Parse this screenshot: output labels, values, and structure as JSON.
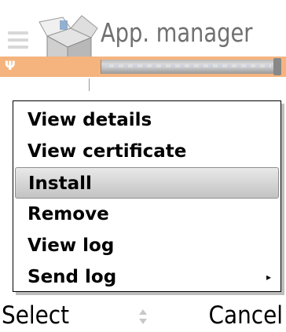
{
  "header": {
    "title": "App. manager",
    "app_icon": "package-box-icon",
    "signal_icon": "antenna-icon"
  },
  "menu": {
    "items": [
      {
        "label": "View details",
        "selected": false
      },
      {
        "label": "View certificate",
        "selected": false
      },
      {
        "label": "Install",
        "selected": true
      },
      {
        "label": "Remove",
        "selected": false
      },
      {
        "label": "View log",
        "selected": false
      },
      {
        "label": "Send log",
        "selected": false,
        "has_submenu": true
      }
    ],
    "submenu_arrow": "▸"
  },
  "softkeys": {
    "left": "Select",
    "right": "Cancel",
    "scroll_icon": "up-down-scroll-icon"
  },
  "colors": {
    "status_strip": "#f5b47e",
    "title_text": "#707070",
    "selection": "#d6d6d6"
  }
}
